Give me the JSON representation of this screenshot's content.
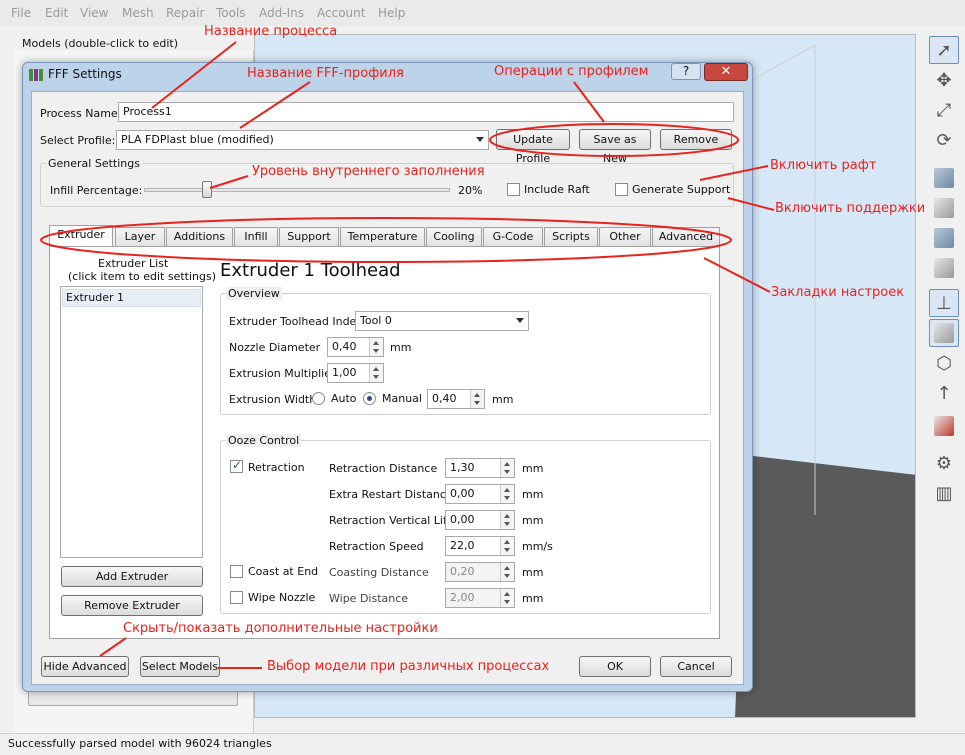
{
  "menubar": [
    "File",
    "Edit",
    "View",
    "Mesh",
    "Repair",
    "Tools",
    "Add-Ins",
    "Account",
    "Help"
  ],
  "models_label": "Models (double-click to edit)",
  "status_text": "Successfully parsed model with 96024 triangles",
  "dialog": {
    "title": "FFF Settings",
    "help": "?",
    "close": "✕",
    "process_name_label": "Process Name:",
    "process_name_value": "Process1",
    "select_profile_label": "Select Profile:",
    "select_profile_value": "PLA FDPlast blue (modified)",
    "update_profile": "Update Profile",
    "save_as_new": "Save as New",
    "remove": "Remove",
    "general_settings": "General Settings",
    "infill_label": "Infill Percentage:",
    "infill_value": "20%",
    "infill_fraction": 0.2,
    "include_raft": "Include Raft",
    "generate_support": "Generate Support",
    "tabs": [
      "Extruder",
      "Layer",
      "Additions",
      "Infill",
      "Support",
      "Temperature",
      "Cooling",
      "G-Code",
      "Scripts",
      "Other",
      "Advanced"
    ],
    "active_tab": "Extruder",
    "extruder_list_title": "Extruder List",
    "extruder_list_hint": "(click item to edit settings)",
    "extruder_item": "Extruder 1",
    "add_extruder": "Add Extruder",
    "remove_extruder": "Remove Extruder",
    "heading": "Extruder 1 Toolhead",
    "overview": "Overview",
    "toolhead_index_label": "Extruder Toolhead Index",
    "toolhead_index_value": "Tool 0",
    "nozzle_label": "Nozzle Diameter",
    "nozzle_value": "0,40",
    "mm": "mm",
    "mms": "mm/s",
    "mult_label": "Extrusion Multiplier",
    "mult_value": "1,00",
    "width_label": "Extrusion Width",
    "auto": "Auto",
    "manual": "Manual",
    "width_value": "0,40",
    "ooze": "Ooze Control",
    "retraction": "Retraction",
    "coast": "Coast at End",
    "wipe": "Wipe Nozzle",
    "retr_dist_label": "Retraction Distance",
    "retr_dist": "1,30",
    "extra_restart_label": "Extra Restart Distance",
    "extra_restart": "0,00",
    "vert_lift_label": "Retraction Vertical Lift",
    "vert_lift": "0,00",
    "retr_speed_label": "Retraction Speed",
    "retr_speed": "22,0",
    "coast_dist_label": "Coasting Distance",
    "coast_dist": "0,20",
    "wipe_dist_label": "Wipe Distance",
    "wipe_dist": "2,00",
    "hide_advanced": "Hide Advanced",
    "select_models": "Select Models",
    "ok": "OK",
    "cancel": "Cancel"
  },
  "annotations": {
    "process_name": "Название процесса",
    "profile_name": "Название FFF-профиля",
    "profile_ops": "Операции с профилем",
    "infill_level": "Уровень внутреннего заполнения",
    "raft": "Включить рафт",
    "support": "Включить поддержки",
    "tabs": "Закладки настроек",
    "advanced": "Скрыть/показать дополнительные настройки",
    "models": "Выбор модели при различных процессах"
  },
  "colors": {
    "annotation": "#e8231c",
    "dialog_frame": "#bcd3ea",
    "viewport": "#d6e7f7"
  }
}
